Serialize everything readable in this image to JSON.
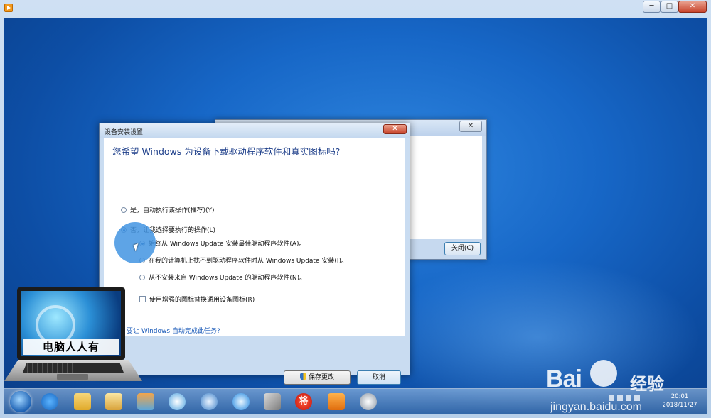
{
  "window": {
    "minimize_label": "─",
    "maximize_label": "□",
    "close_label": "✕"
  },
  "back_dialog": {
    "close_x": "✕",
    "close_button": "关闭(C)"
  },
  "dialog": {
    "title": "设备安装设置",
    "close_x": "✕",
    "question": "您希望 Windows 为设备下载驱动程序软件和真实图标吗?",
    "option_yes": "是，自动执行该操作(推荐)(Y)",
    "option_no": "否，让我选择要执行的操作(L)",
    "sub_option_always": "始终从 Windows Update 安装最佳驱动程序软件(A)。",
    "sub_option_fallback": "在我的计算机上找不到驱动程序软件时从 Windows Update 安装(I)。",
    "sub_option_never": "从不安装来自 Windows Update 的驱动程序软件(N)。",
    "checkbox_icons": "使用增强的图标替换通用设备图标(R)",
    "help_link": "要让 Windows 自动完成此任务?",
    "save_button": "保存更改",
    "cancel_button": "取消",
    "selected_option": "option_no",
    "selected_sub_option": "sub_option_always",
    "checkbox_checked": false
  },
  "taskbar": {
    "chess_label": "将",
    "clock_time": "20:01",
    "clock_date": "2018/11/27"
  },
  "watermark": {
    "laptop_text": "电脑人人有",
    "baidu_word": "Bai",
    "baidu_jingyan": "经验",
    "baidu_url": "jingyan.baidu.com"
  }
}
